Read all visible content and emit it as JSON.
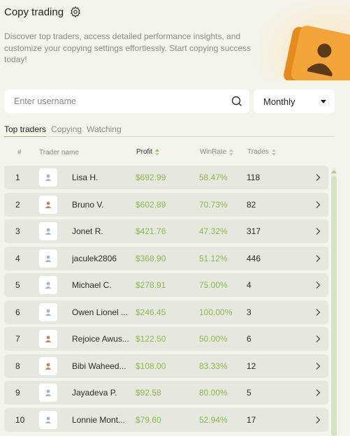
{
  "header": {
    "title": "Copy trading"
  },
  "description": "Discover top traders, access detailed performance insights, and customize your copying settings effortlessly. Start copying success today!",
  "search": {
    "placeholder": "Enter username",
    "value": ""
  },
  "period": {
    "selected": "Monthly"
  },
  "tabs": [
    "Top traders",
    "Copying",
    "Watching"
  ],
  "columns": {
    "rank": "#",
    "name": "Trader name",
    "profit": "Profit",
    "winrate": "WinRate",
    "trades": "Trades"
  },
  "colors": {
    "accent": "#8ab84d",
    "row_bg": "#e6e8df",
    "hero_orange": "#f4a53a"
  },
  "traders": [
    {
      "rank": "1",
      "name": "Lisa H.",
      "profit": "$692.99",
      "winrate": "58.47%",
      "trades": "118",
      "avatar": "user-icon-blue"
    },
    {
      "rank": "2",
      "name": "Bruno V.",
      "profit": "$602.89",
      "winrate": "70.73%",
      "trades": "82",
      "avatar": "user-icon-orange"
    },
    {
      "rank": "3",
      "name": "Jonet R.",
      "profit": "$421.76",
      "winrate": "47.32%",
      "trades": "317",
      "avatar": "user-icon-blue"
    },
    {
      "rank": "4",
      "name": "jaculek2806",
      "profit": "$368.90",
      "winrate": "51.12%",
      "trades": "446",
      "avatar": "user-icon-blue"
    },
    {
      "rank": "5",
      "name": "Michael C.",
      "profit": "$278.91",
      "winrate": "75.00%",
      "trades": "4",
      "avatar": "user-icon-blue"
    },
    {
      "rank": "6",
      "name": "Owen Lionel ...",
      "profit": "$246.45",
      "winrate": "100.00%",
      "trades": "3",
      "avatar": "user-icon-blue"
    },
    {
      "rank": "7",
      "name": "Rejoice Awus...",
      "profit": "$122.50",
      "winrate": "50.00%",
      "trades": "6",
      "avatar": "user-icon-orange"
    },
    {
      "rank": "8",
      "name": "Bibi Waheed...",
      "profit": "$108.00",
      "winrate": "83.33%",
      "trades": "12",
      "avatar": "user-icon-orange"
    },
    {
      "rank": "9",
      "name": "Jayadeva P.",
      "profit": "$92.58",
      "winrate": "80.00%",
      "trades": "5",
      "avatar": "user-icon-blue"
    },
    {
      "rank": "10",
      "name": "Lonnie Mont...",
      "profit": "$79.60",
      "winrate": "52.94%",
      "trades": "17",
      "avatar": "user-icon-blue"
    }
  ]
}
